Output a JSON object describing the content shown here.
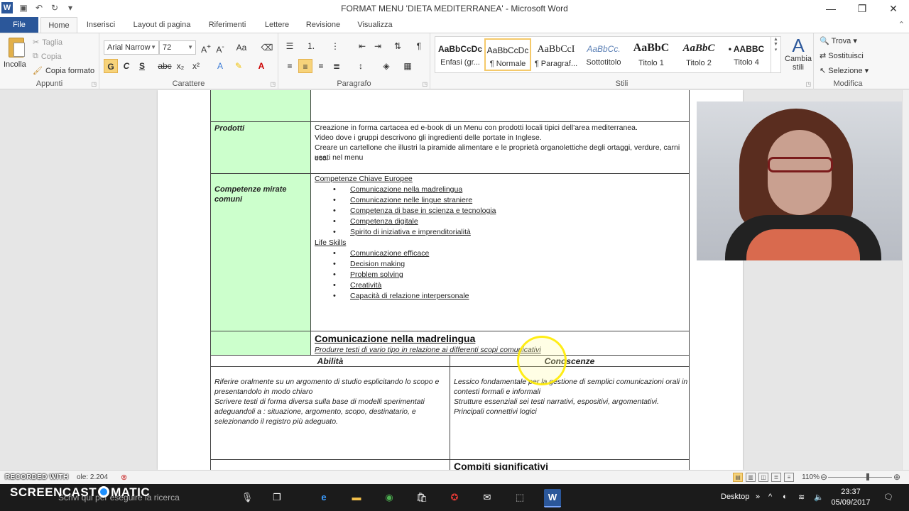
{
  "window": {
    "title": "FORMAT MENU 'DIETA MEDITERRANEA'  -  Microsoft Word",
    "app_icon": "W",
    "controls": {
      "minimize": "—",
      "maximize": "❐",
      "close": "✕"
    }
  },
  "tabs": [
    "File",
    "Home",
    "Inserisci",
    "Layout di pagina",
    "Riferimenti",
    "Lettere",
    "Revisione",
    "Visualizza"
  ],
  "ribbon": {
    "clipboard": {
      "paste": "Incolla",
      "cut": "Taglia",
      "copy": "Copia",
      "format_painter": "Copia formato",
      "label": "Appunti"
    },
    "font": {
      "name": "Arial Narrow",
      "size": "72",
      "label": "Carattere"
    },
    "paragraph": {
      "label": "Paragrafo"
    },
    "styles": {
      "label": "Stili",
      "items": [
        {
          "preview": "AaBbCcDc",
          "name": "Enfasi (gr..."
        },
        {
          "preview": "AaBbCcDc",
          "name": "¶ Normale"
        },
        {
          "preview": "AaBbCcI",
          "name": "¶ Paragraf..."
        },
        {
          "preview": "AaBbCc.",
          "name": "Sottotitolo"
        },
        {
          "preview": "AaBbC",
          "name": "Titolo 1"
        },
        {
          "preview": "AaBbC",
          "name": "Titolo 2"
        },
        {
          "preview": "• AABBC",
          "name": "Titolo 4"
        }
      ],
      "change": "Cambia stili"
    },
    "editing": {
      "label": "Modifica",
      "find": "Trova",
      "replace": "Sostituisci",
      "select": "Selezione"
    }
  },
  "document": {
    "rows": {
      "prodotti": {
        "label": "Prodotti",
        "lines": [
          "Creazione in  forma cartacea  ed  e-book  di un  Menu con prodotti locali tipici  dell'area mediterranea.",
          "Video dove i gruppi descrivono  gli ingredienti delle portate in Inglese.",
          "Creare un cartellone che illustri  la piramide alimentare e le proprietà organolettiche  degli ortaggi, verdure, carni ecc.",
          "usati nel menu"
        ]
      },
      "competenze": {
        "label_line1": "Competenze mirate",
        "label_line2": "comuni",
        "heading1": "Competenze  Chiave Europee",
        "list1": [
          "Comunicazione  nella madrelingua",
          "Comunicazione  nelle lingue straniere",
          "Competenza di base in scienza  e tecnologia",
          "Competenza digitale",
          "Spirito di iniziativa  e imprenditorialità"
        ],
        "heading2": "Life Skills",
        "list2": [
          "Comunicazione  efficace",
          "Decision  making",
          "Problem solving",
          "Creatività",
          "Capacità di relazione  interpersonale"
        ]
      },
      "comunicazione": {
        "title": "Comunicazione nella madrelingua",
        "subtitle": "Produrre testi di vario tipo in relazione ai differenti scopi comunicativi"
      },
      "abilita": {
        "header": "Abilità",
        "lines": [
          "Riferire oralmente su un  argomento di studio esplicitando  lo scopo e",
          "presentandolo in modo chiaro",
          "Scrivere testi di forma diversa sulla  base di modelli sperimentati",
          "adeguandoli a : situazione,  argomento, scopo, destinatario,  e",
          "selezionando  il registro più adeguato."
        ]
      },
      "conoscenze": {
        "header": "Conoscenze",
        "lines": [
          "Lessico  fondamentale per la gestione di semplici comunicazioni  orali in",
          "contesti formali e informali",
          "Strutture essenziali sei testi narrativi, espositivi,  argomentativi.",
          "Principali  connettivi logici"
        ]
      },
      "compiti": {
        "title": "Compiti significativi"
      }
    }
  },
  "statusbar": {
    "watermark": "RECORDED WITH",
    "word_count": "ole: 2.204",
    "zoom": "110%"
  },
  "taskbar": {
    "logo_left": "SCREENCAST",
    "logo_right": "MATIC",
    "search_placeholder": "Scrivi qui per eseguire la ricerca",
    "desktop_label": "Desktop",
    "time": "23:37",
    "date": "05/09/2017"
  }
}
